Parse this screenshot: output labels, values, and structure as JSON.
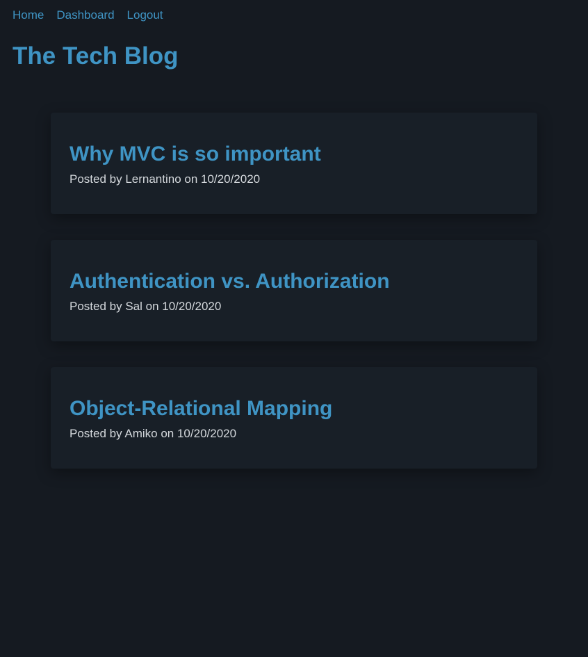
{
  "nav": {
    "home": "Home",
    "dashboard": "Dashboard",
    "logout": "Logout"
  },
  "site": {
    "title": "The Tech Blog"
  },
  "posts": [
    {
      "title": "Why MVC is so important",
      "meta": "Posted by Lernantino on 10/20/2020"
    },
    {
      "title": "Authentication vs. Authorization",
      "meta": "Posted by Sal on 10/20/2020"
    },
    {
      "title": "Object-Relational Mapping",
      "meta": "Posted by Amiko on 10/20/2020"
    }
  ],
  "colors": {
    "background": "#151a21",
    "card": "#181f27",
    "accent": "#3f94c4",
    "text": "#d4d8dc"
  }
}
